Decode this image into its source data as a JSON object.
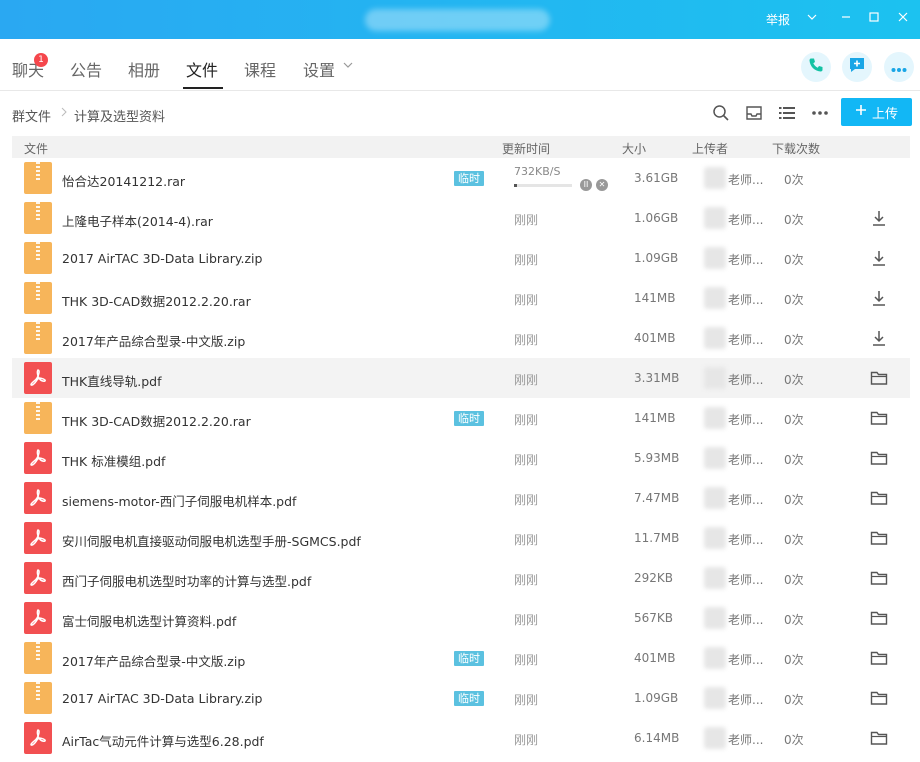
{
  "titlebar": {
    "report_label": "举报"
  },
  "tabs": [
    {
      "label": "聊天",
      "badge": "1"
    },
    {
      "label": "公告"
    },
    {
      "label": "相册"
    },
    {
      "label": "文件",
      "active": true
    },
    {
      "label": "课程"
    },
    {
      "label": "设置"
    }
  ],
  "breadcrumb": {
    "root": "群文件",
    "current": "计算及选型资料"
  },
  "toolbar": {
    "upload_label": "上传"
  },
  "columns": {
    "file": "文件",
    "time": "更新时间",
    "size": "大小",
    "uploader": "上传者",
    "downloads": "下载次数"
  },
  "colors": {
    "accent": "#12b7f5",
    "zip": "#f7b55a",
    "pdf": "#f25051",
    "temp_badge": "#5bc1e0"
  },
  "files": [
    {
      "name": "怡合达20141212.rar",
      "type": "zip",
      "temp": "临时",
      "time": "",
      "speed": "732KB/S",
      "progress": 0.05,
      "size": "3.61GB",
      "uploader": "老师...",
      "downloads": "0次",
      "action": "none"
    },
    {
      "name": "上隆电子样本(2014-4).rar",
      "type": "zip",
      "time": "刚刚",
      "size": "1.06GB",
      "uploader": "老师...",
      "downloads": "0次",
      "action": "download"
    },
    {
      "name": "2017 AirTAC 3D-Data Library.zip",
      "type": "zip",
      "time": "刚刚",
      "size": "1.09GB",
      "uploader": "老师...",
      "downloads": "0次",
      "action": "download"
    },
    {
      "name": "THK 3D-CAD数据2012.2.20.rar",
      "type": "zip",
      "time": "刚刚",
      "size": "141MB",
      "uploader": "老师...",
      "downloads": "0次",
      "action": "download"
    },
    {
      "name": "2017年产品综合型录-中文版.zip",
      "type": "zip",
      "time": "刚刚",
      "size": "401MB",
      "uploader": "老师...",
      "downloads": "0次",
      "action": "download"
    },
    {
      "name": "THK直线导轨.pdf",
      "type": "pdf",
      "time": "刚刚",
      "size": "3.31MB",
      "uploader": "老师...",
      "downloads": "0次",
      "action": "folder",
      "highlight": true
    },
    {
      "name": "THK 3D-CAD数据2012.2.20.rar",
      "type": "zip",
      "temp": "临时",
      "time": "刚刚",
      "size": "141MB",
      "uploader": "老师...",
      "downloads": "0次",
      "action": "folder"
    },
    {
      "name": "THK 标准模组.pdf",
      "type": "pdf",
      "time": "刚刚",
      "size": "5.93MB",
      "uploader": "老师...",
      "downloads": "0次",
      "action": "folder"
    },
    {
      "name": "siemens-motor-西门子伺服电机样本.pdf",
      "type": "pdf",
      "time": "刚刚",
      "size": "7.47MB",
      "uploader": "老师...",
      "downloads": "0次",
      "action": "folder"
    },
    {
      "name": "安川伺服电机直接驱动伺服电机选型手册-SGMCS.pdf",
      "type": "pdf",
      "time": "刚刚",
      "size": "11.7MB",
      "uploader": "老师...",
      "downloads": "0次",
      "action": "folder"
    },
    {
      "name": "西门子伺服电机选型时功率的计算与选型.pdf",
      "type": "pdf",
      "time": "刚刚",
      "size": "292KB",
      "uploader": "老师...",
      "downloads": "0次",
      "action": "folder"
    },
    {
      "name": "富士伺服电机选型计算资料.pdf",
      "type": "pdf",
      "time": "刚刚",
      "size": "567KB",
      "uploader": "老师...",
      "downloads": "0次",
      "action": "folder"
    },
    {
      "name": "2017年产品综合型录-中文版.zip",
      "type": "zip",
      "temp": "临时",
      "time": "刚刚",
      "size": "401MB",
      "uploader": "老师...",
      "downloads": "0次",
      "action": "folder"
    },
    {
      "name": "2017 AirTAC 3D-Data Library.zip",
      "type": "zip",
      "temp": "临时",
      "time": "刚刚",
      "size": "1.09GB",
      "uploader": "老师...",
      "downloads": "0次",
      "action": "folder"
    },
    {
      "name": "AirTac气动元件计算与选型6.28.pdf",
      "type": "pdf",
      "time": "刚刚",
      "size": "6.14MB",
      "uploader": "老师...",
      "downloads": "0次",
      "action": "folder"
    }
  ]
}
